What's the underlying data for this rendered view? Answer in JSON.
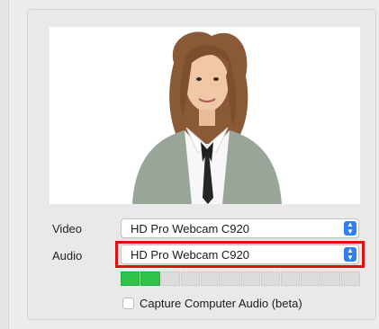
{
  "video": {
    "label": "Video",
    "selected": "HD Pro Webcam C920"
  },
  "audio": {
    "label": "Audio",
    "selected": "HD Pro Webcam C920"
  },
  "audio_meter": {
    "segments_total": 12,
    "segments_active": 2,
    "active_color": "#2fc34a"
  },
  "capture_audio": {
    "label": "Capture Computer Audio (beta)",
    "checked": false
  },
  "colors": {
    "accent": "#2f7ff3",
    "highlight": "#e01010"
  }
}
